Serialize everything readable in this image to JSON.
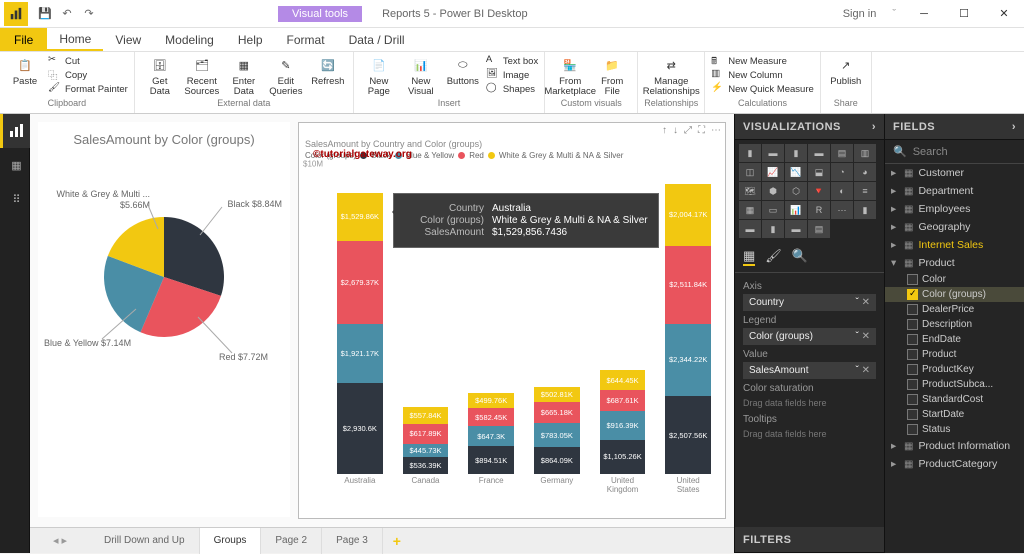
{
  "titlebar": {
    "visual_tools": "Visual tools",
    "title": "Reports 5 - Power BI Desktop",
    "signin": "Sign in"
  },
  "menubar": {
    "file": "File",
    "tabs": [
      "Home",
      "View",
      "Modeling",
      "Help",
      "Format",
      "Data / Drill"
    ]
  },
  "ribbon": {
    "clipboard": {
      "label": "Clipboard",
      "paste": "Paste",
      "cut": "Cut",
      "copy": "Copy",
      "format_painter": "Format Painter"
    },
    "external": {
      "label": "External data",
      "get_data": "Get Data",
      "recent": "Recent Sources",
      "enter": "Enter Data",
      "edit_q": "Edit Queries",
      "refresh": "Refresh"
    },
    "insert": {
      "label": "Insert",
      "new_page": "New Page",
      "new_visual": "New Visual",
      "buttons": "Buttons",
      "text_box": "Text box",
      "image": "Image",
      "shapes": "Shapes"
    },
    "custom": {
      "label": "Custom visuals",
      "marketplace": "From Marketplace",
      "file": "From File"
    },
    "rel": {
      "label": "Relationships",
      "manage": "Manage Relationships"
    },
    "calc": {
      "label": "Calculations",
      "measure": "New Measure",
      "column": "New Column",
      "quick": "New Quick Measure"
    },
    "share": {
      "label": "Share",
      "publish": "Publish"
    }
  },
  "pie": {
    "title": "SalesAmount by Color (groups)",
    "labels": {
      "wgmns": "White & Grey & Multi ...\n$5.66M",
      "black": "Black $8.84M",
      "by": "Blue & Yellow\n$7.14M",
      "red": "Red $7.72M"
    }
  },
  "bar": {
    "title": "SalesAmount by Country and Color (groups)",
    "legend_label": "Color (groups)",
    "legend": [
      "Black",
      "Blue & Yellow",
      "Red",
      "White & Grey & Multi & NA & Silver"
    ],
    "ymax_label": "$10M",
    "watermark": "©tutorialgateway.org",
    "xcats": [
      "Australia",
      "Canada",
      "France",
      "Germany",
      "United Kingdom",
      "United States"
    ]
  },
  "chart_data": {
    "colors": {
      "Black": "#2f3640",
      "Blue & Yellow": "#4a8ea6",
      "Red": "#e9545d",
      "White & Grey & Multi & NA & Silver": "#f2c811"
    },
    "pie": {
      "type": "pie",
      "slices": [
        {
          "name": "Black",
          "value": 8.84
        },
        {
          "name": "Red",
          "value": 7.72
        },
        {
          "name": "Blue & Yellow",
          "value": 7.14
        },
        {
          "name": "White & Grey & Multi & NA & Silver",
          "value": 5.66
        }
      ]
    },
    "bar": {
      "type": "bar-stacked",
      "ylim": [
        0,
        10
      ],
      "unit": "M",
      "categories": [
        "Australia",
        "Canada",
        "France",
        "Germany",
        "United Kingdom",
        "United States"
      ],
      "series": [
        {
          "name": "Black",
          "values": [
            2.9306,
            0.53639,
            0.89451,
            0.86409,
            1.10526,
            2.50756
          ],
          "labels": [
            "$2,930.6K",
            "$536.39K",
            "$894.51K",
            "$864.09K",
            "$1,105.26K",
            "$2,507.56K"
          ]
        },
        {
          "name": "Blue & Yellow",
          "values": [
            1.92117,
            0.44573,
            0.6473,
            0.78305,
            0.91639,
            2.34422
          ],
          "labels": [
            "$1,921.17K",
            "$445.73K",
            "$647.3K",
            "$783.05K",
            "$916.39K",
            "$2,344.22K"
          ]
        },
        {
          "name": "Red",
          "values": [
            2.67937,
            0.61789,
            0.58245,
            0.66518,
            0.68761,
            2.51184
          ],
          "labels": [
            "$2,679.37K",
            "$617.89K",
            "$582.45K",
            "$665.18K",
            "$687.61K",
            "$2,511.84K"
          ]
        },
        {
          "name": "White & Grey & Multi & NA & Silver",
          "values": [
            1.52986,
            0.55784,
            0.49976,
            0.50281,
            0.64445,
            2.00417
          ],
          "labels": [
            "$1,529.86K",
            "$557.84K",
            "$499.76K",
            "$502.81K",
            "$644.45K",
            "$2,004.17K"
          ]
        }
      ]
    }
  },
  "tooltip": {
    "k1": "Country",
    "v1": "Australia",
    "k2": "Color (groups)",
    "v2": "White & Grey & Multi & NA & Silver",
    "k3": "SalesAmount",
    "v3": "$1,529,856.7436"
  },
  "pagetabs": [
    "Drill Down and Up",
    "Groups",
    "Page 2",
    "Page 3"
  ],
  "vis_panel": {
    "title": "VISUALIZATIONS",
    "axis": "Axis",
    "axis_v": "Country",
    "legend": "Legend",
    "legend_v": "Color (groups)",
    "value": "Value",
    "value_v": "SalesAmount",
    "colorsat": "Color saturation",
    "tooltips": "Tooltips",
    "drag": "Drag data fields here",
    "filters": "FILTERS"
  },
  "fields_panel": {
    "title": "FIELDS",
    "search": "Search",
    "tables": [
      "Customer",
      "Department",
      "Employees",
      "Geography",
      "Internet Sales",
      "Product",
      "Product Information",
      "ProductCategory"
    ],
    "product_fields": [
      "Color",
      "Color (groups)",
      "DealerPrice",
      "Description",
      "EndDate",
      "Product",
      "ProductKey",
      "ProductSubca...",
      "StandardCost",
      "StartDate",
      "Status"
    ]
  }
}
